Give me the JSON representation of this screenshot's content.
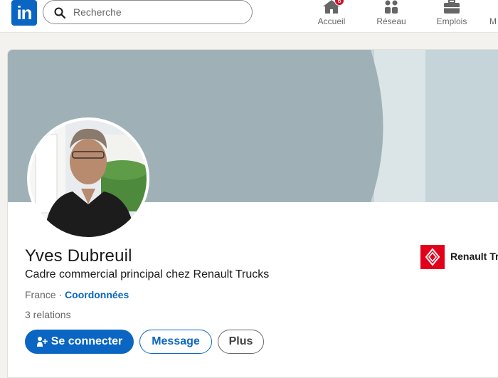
{
  "nav": {
    "logo_text": "in",
    "search_placeholder": "Recherche",
    "items": [
      {
        "label": "Accueil",
        "icon": "home-icon",
        "badge": "6"
      },
      {
        "label": "Réseau",
        "icon": "network-icon"
      },
      {
        "label": "Emplois",
        "icon": "briefcase-icon"
      },
      {
        "label": "M",
        "icon": "messaging-icon"
      }
    ]
  },
  "profile": {
    "name": "Yves Dubreuil",
    "headline": "Cadre commercial principal chez Renault Trucks",
    "location": "France",
    "separator": " · ",
    "contact_link": "Coordonnées",
    "relations": "3 relations",
    "company": "Renault Tr",
    "actions": {
      "connect": "Se connecter",
      "message": "Message",
      "more": "Plus"
    }
  },
  "colors": {
    "brand": "#0a66c2",
    "banner_dark": "#9fb1b6",
    "banner_light": "#c4d4d8",
    "renault_red": "#e3001b"
  }
}
